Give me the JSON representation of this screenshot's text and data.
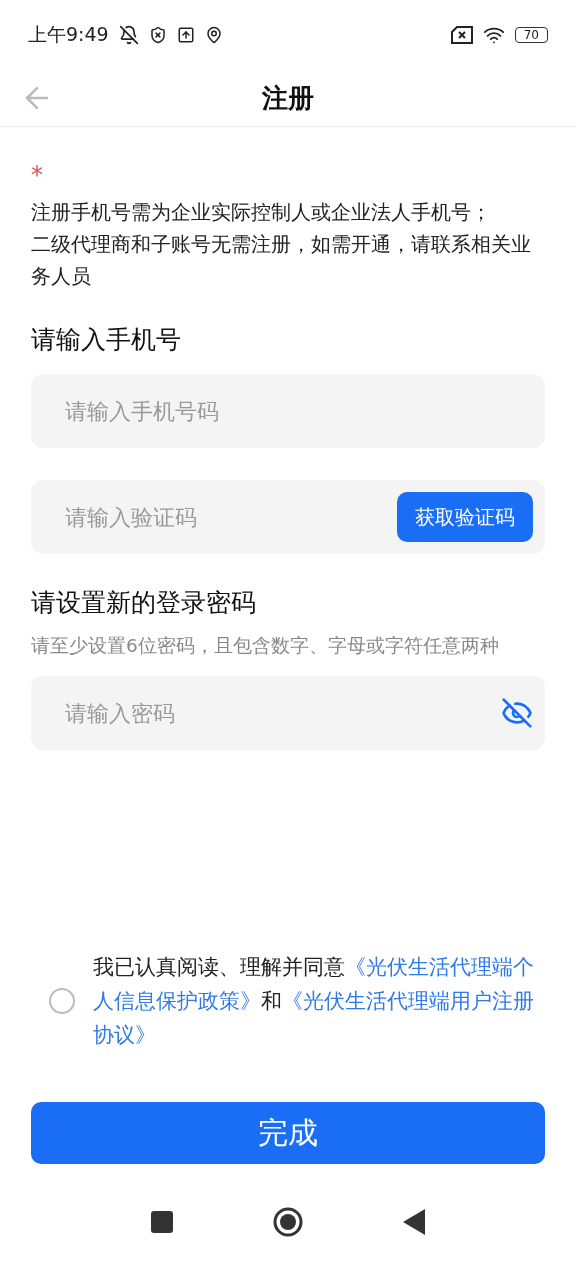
{
  "status_bar": {
    "time": "上午9:49",
    "battery": "70"
  },
  "header": {
    "title": "注册"
  },
  "notice": {
    "required_mark": "*",
    "lines": [
      "注册手机号需为企业实际控制人或企业法人手机号；",
      "二级代理商和子账号无需注册，如需开通，请联系相关业务人员"
    ]
  },
  "phone_section": {
    "title": "请输入手机号",
    "phone_field": {
      "placeholder": "请输入手机号码"
    },
    "code_field": {
      "placeholder": "请输入验证码"
    },
    "code_button": "获取验证码"
  },
  "password_section": {
    "title": "请设置新的登录密码",
    "hint": "请至少设置6位密码，且包含数字、字母或字符任意两种",
    "password_field": {
      "placeholder": "请输入密码",
      "visible": false
    }
  },
  "agreement": {
    "checked": false,
    "parts": [
      {
        "kind": "text",
        "text": "我已认真阅读、理解并同意"
      },
      {
        "kind": "link",
        "text": "《光伏生活代理端个人信息保护政策》"
      },
      {
        "kind": "text",
        "text": "和"
      },
      {
        "kind": "link",
        "text": "《光伏生活代理端用户注册协议》"
      }
    ]
  },
  "submit_button": "完成"
}
